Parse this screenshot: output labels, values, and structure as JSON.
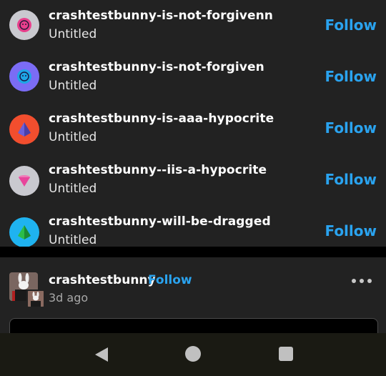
{
  "suggestions": [
    {
      "name": "crashtestbunny-is-not-forgivenn",
      "subtitle": "Untitled",
      "follow_label": "Follow",
      "avatar_color": "#c9c9cf",
      "icon_color": "#e83f8c",
      "icon": "smiley-face-icon"
    },
    {
      "name": "crashtestbunny-is-not-forgiven",
      "subtitle": "Untitled",
      "follow_label": "Follow",
      "avatar_color": "#7b6cf5",
      "icon_color": "#1ea6e6",
      "icon": "smiley-face-icon"
    },
    {
      "name": "crashtestbunny-is-aaa-hypocrite",
      "subtitle": "Untitled",
      "follow_label": "Follow",
      "avatar_color": "#f24e2e",
      "icon_color": "#6b5fd9",
      "icon": "pyramid-icon"
    },
    {
      "name": "crashtestbunny--iis-a-hypocrite",
      "subtitle": "Untitled",
      "follow_label": "Follow",
      "avatar_color": "#c9c9cf",
      "icon_color": "#e8459b",
      "icon": "cone-icon"
    },
    {
      "name": "crashtestbunny-will-be-dragged",
      "subtitle": "Untitled",
      "follow_label": "Follow",
      "avatar_color": "#1fb3f0",
      "icon_color": "#2bbd4a",
      "icon": "pyramid-icon"
    }
  ],
  "post": {
    "author": "crashtestbunny",
    "follow_label": "Follow",
    "time": "3d ago"
  },
  "colors": {
    "accent": "#2aa3ef",
    "background": "#222222"
  }
}
